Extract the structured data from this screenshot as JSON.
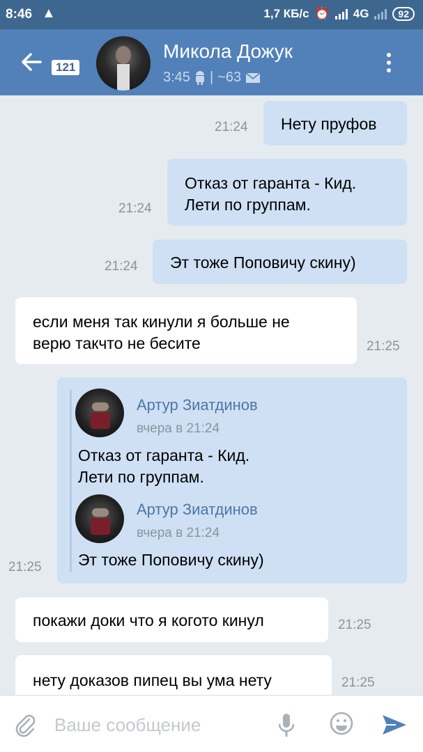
{
  "status_bar": {
    "time": "8:46",
    "warning_icon": "warning-icon",
    "network_speed": "1,7 КБ/с",
    "network_type": "4G",
    "battery": "92"
  },
  "header": {
    "unread_count": "121",
    "contact_name": "Микола Дожук",
    "last_seen": "3:45",
    "platform_icon": "android-icon",
    "separator": "|",
    "unread_mail": "~63",
    "mail_icon": "envelope-icon"
  },
  "messages": [
    {
      "direction": "out",
      "lines": [
        "Нету пруфов"
      ],
      "time": "21:24"
    },
    {
      "direction": "out",
      "lines": [
        "Отказ от гаранта - Кид.",
        "Лети по группам."
      ],
      "time": "21:24"
    },
    {
      "direction": "out",
      "lines": [
        "Эт тоже Поповичу скину)"
      ],
      "time": "21:24"
    },
    {
      "direction": "in",
      "lines": [
        "если меня так кинули я больше не",
        "верю такчто не бесите"
      ],
      "time": "21:25"
    },
    {
      "direction": "out",
      "time": "21:25",
      "forwarded": [
        {
          "author": "Артур Зиатдинов",
          "date": "вчера в 21:24",
          "lines": [
            "Отказ от гаранта - Кид.",
            "Лети по группам."
          ]
        },
        {
          "author": "Артур Зиатдинов",
          "date": "вчера в 21:24",
          "lines": [
            "Эт тоже Поповичу скину)"
          ]
        }
      ]
    },
    {
      "direction": "in",
      "lines": [
        "покажи доки что я когото кинул"
      ],
      "time": "21:25"
    },
    {
      "direction": "in",
      "lines": [
        "нету доказов пипец вы ума нету"
      ],
      "time": "21:25"
    }
  ],
  "composer": {
    "placeholder": "Ваше сообщение",
    "value": ""
  },
  "colors": {
    "status_bar": "#3e6790",
    "header": "#5181b8",
    "chat_background": "#e6ebf0",
    "outgoing_bubble": "#cfe0f4",
    "incoming_bubble": "#ffffff",
    "forward_author": "#4d76a5",
    "send_icon": "#5181b8"
  }
}
